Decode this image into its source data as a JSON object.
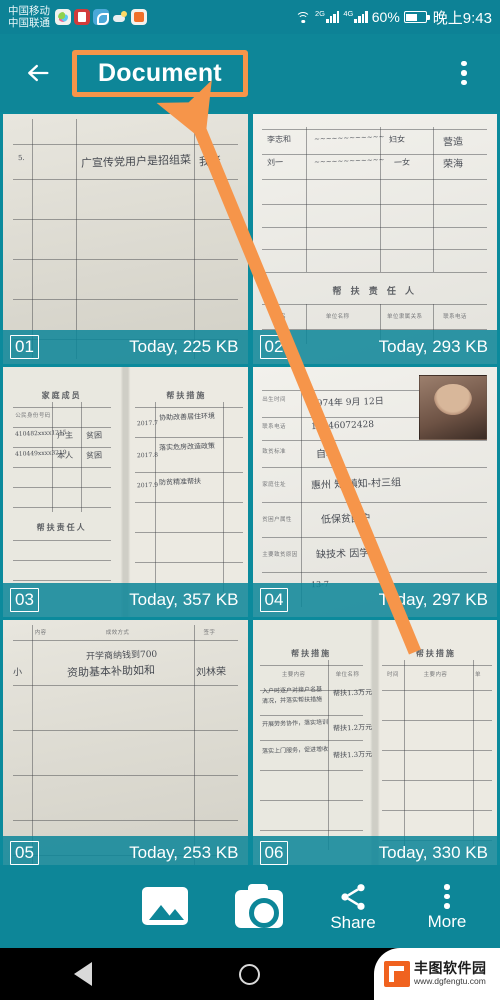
{
  "status_bar": {
    "carrier_line1": "中国移动",
    "carrier_line2": "中国联通",
    "app_icons": [
      "photos-icon",
      "app-red-icon",
      "link-blue-icon",
      "weather-cloud-icon",
      "video-orange-icon"
    ],
    "wifi": "wifi-icon",
    "signal_1_label": "2G",
    "signal_2_label": "4G",
    "battery_percent": "60%",
    "time": "晚上9:43"
  },
  "app_bar": {
    "back_label": "back-arrow",
    "title": "Document",
    "overflow_label": "overflow-menu",
    "highlight_color": "#f6954a"
  },
  "grid": {
    "tiles": [
      {
        "number": "01",
        "meta": "Today, 225 KB"
      },
      {
        "number": "02",
        "meta": "Today, 293 KB"
      },
      {
        "number": "03",
        "meta": "Today, 357 KB"
      },
      {
        "number": "04",
        "meta": "Today, 297 KB"
      },
      {
        "number": "05",
        "meta": "Today, 253 KB"
      },
      {
        "number": "06",
        "meta": "Today, 330 KB"
      }
    ],
    "doc_text": {
      "t02_heading": "帮 扶 责 任 人",
      "t02_cols": [
        "姓名",
        "单位名称",
        "单位隶属关系",
        "联系电话"
      ],
      "t03_heading_left": "家庭成员",
      "t03_heading_right": "帮扶措施",
      "t03_sub_left": "帮扶责任人",
      "t05_cols": [
        "内容",
        "成效方式",
        "签字"
      ],
      "t06_heading_left": "帮扶措施",
      "t06_heading_right": "帮扶措施"
    }
  },
  "bottom_bar": {
    "items": [
      {
        "icon": "gallery-icon",
        "label": ""
      },
      {
        "icon": "camera-icon",
        "label": ""
      },
      {
        "icon": "share-icon",
        "label": "Share"
      },
      {
        "icon": "more-icon",
        "label": "More"
      }
    ]
  },
  "nav_bar": {
    "back": "nav-back-icon",
    "home": "nav-home-icon",
    "recents": "nav-recents-icon"
  },
  "watermark": {
    "name": "丰图软件园",
    "url": "www.dgfengtu.com",
    "logo_color": "#f0621f"
  },
  "theme": {
    "teal": "#0d8698",
    "teal_dark": "#0b8a9c",
    "accent_orange": "#f6954a"
  }
}
